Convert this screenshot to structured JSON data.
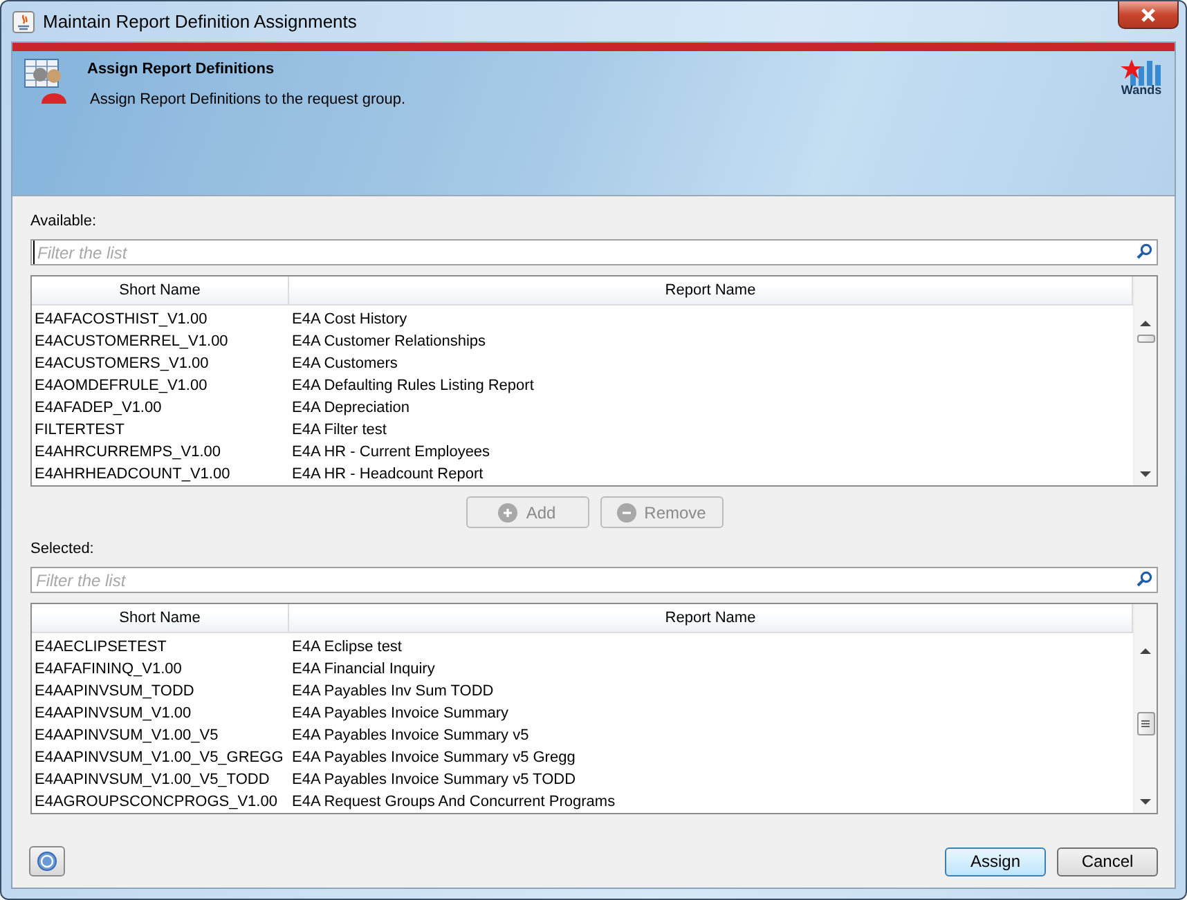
{
  "window": {
    "title": "Maintain Report Definition Assignments"
  },
  "banner": {
    "title": "Assign Report Definitions",
    "subtitle": "Assign Report Definitions to the request group.",
    "logo_text": "Wands"
  },
  "available": {
    "label": "Available:",
    "filter": {
      "placeholder": "Filter the list",
      "focused": true
    },
    "columns": [
      "Short Name",
      "Report Name"
    ],
    "rows": [
      [
        "E4AFACOSTHIST_V1.00",
        "E4A Cost History"
      ],
      [
        "E4ACUSTOMERREL_V1.00",
        "E4A Customer Relationships"
      ],
      [
        "E4ACUSTOMERS_V1.00",
        "E4A Customers"
      ],
      [
        "E4AOMDEFRULE_V1.00",
        "E4A Defaulting Rules Listing Report"
      ],
      [
        "E4AFADEP_V1.00",
        "E4A Depreciation"
      ],
      [
        "FILTERTEST",
        "E4A Filter test"
      ],
      [
        "E4AHRCURREMPS_V1.00",
        "E4A HR - Current Employees"
      ],
      [
        "E4AHRHEADCOUNT_V1.00",
        "E4A HR - Headcount Report"
      ]
    ]
  },
  "move_buttons": [
    {
      "kind": "add",
      "label": "Add",
      "disabled": true
    },
    {
      "kind": "remove",
      "label": "Remove",
      "disabled": true
    }
  ],
  "selected": {
    "label": "Selected:",
    "filter": {
      "placeholder": "Filter the list",
      "focused": false
    },
    "columns": [
      "Short Name",
      "Report Name"
    ],
    "rows": [
      [
        "E4AECLIPSETEST",
        "E4A Eclipse test"
      ],
      [
        "E4AFAFININQ_V1.00",
        "E4A Financial Inquiry"
      ],
      [
        "E4AAPINVSUM_TODD",
        "E4A Payables Inv Sum TODD"
      ],
      [
        "E4AAPINVSUM_V1.00",
        "E4A Payables Invoice Summary"
      ],
      [
        "E4AAPINVSUM_V1.00_V5",
        "E4A Payables Invoice Summary v5"
      ],
      [
        "E4AAPINVSUM_V1.00_V5_GREGG",
        "E4A Payables Invoice Summary v5 Gregg"
      ],
      [
        "E4AAPINVSUM_V1.00_V5_TODD",
        "E4A Payables Invoice Summary v5 TODD"
      ],
      [
        "E4AGROUPSCONCPROGS_V1.00",
        "E4A Request Groups And Concurrent Programs"
      ]
    ]
  },
  "buttons": [
    {
      "label": "Assign",
      "default": true
    },
    {
      "label": "Cancel",
      "default": false
    }
  ]
}
